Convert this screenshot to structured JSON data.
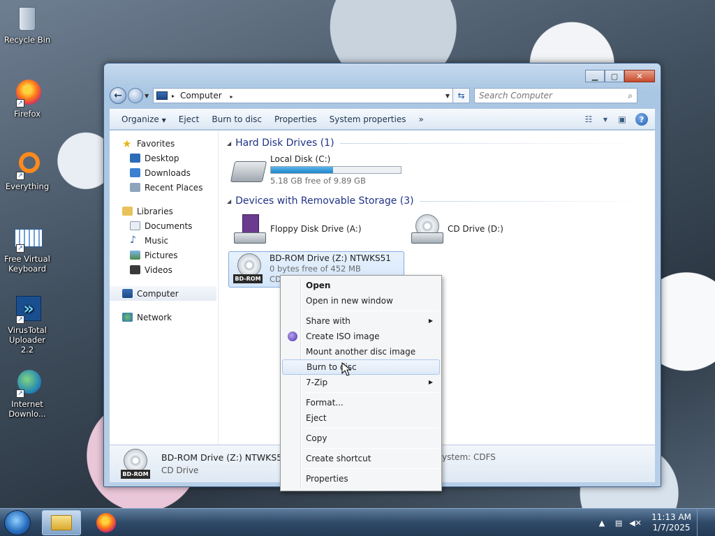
{
  "desktop": {
    "icons": [
      {
        "label": "Recycle Bin"
      },
      {
        "label": "Firefox"
      },
      {
        "label": "Everything"
      },
      {
        "label": "Free Virtual Keyboard"
      },
      {
        "label": "VirusTotal Uploader 2.2"
      },
      {
        "label": "Internet Downlo..."
      }
    ]
  },
  "window": {
    "address": {
      "path": "Computer",
      "separator": "▸"
    },
    "search": {
      "placeholder": "Search Computer"
    },
    "toolbar": {
      "organize": "Organize",
      "eject": "Eject",
      "burn": "Burn to disc",
      "properties": "Properties",
      "system_properties": "System properties",
      "more": "»"
    },
    "nav": {
      "favorites": "Favorites",
      "desktop": "Desktop",
      "downloads": "Downloads",
      "recent": "Recent Places",
      "libraries": "Libraries",
      "documents": "Documents",
      "music": "Music",
      "pictures": "Pictures",
      "videos": "Videos",
      "computer": "Computer",
      "network": "Network"
    },
    "groups": {
      "hdd": "Hard Disk Drives (1)",
      "removable": "Devices with Removable Storage (3)"
    },
    "drives": {
      "c": {
        "name": "Local Disk (C:)",
        "free": "5.18 GB free of 9.89 GB",
        "used_fraction": 0.476
      },
      "a": {
        "name": "Floppy Disk Drive (A:)"
      },
      "d": {
        "name": "CD Drive (D:)"
      },
      "z": {
        "name": "BD-ROM Drive (Z:) NTWKS51",
        "free": "0 bytes free of 452 MB",
        "fs": "CD",
        "tag": "BD-ROM"
      }
    },
    "details": {
      "name": "BD-ROM Drive (Z:) NTWKS51",
      "type": "CD Drive",
      "filesystem": "ystem: CDFS",
      "tag": "BD-ROM"
    }
  },
  "context_menu": {
    "open": "Open",
    "open_new": "Open in new window",
    "share": "Share with",
    "create_iso": "Create ISO image",
    "mount": "Mount another disc image",
    "burn": "Burn to disc",
    "zip": "7-Zip",
    "format": "Format...",
    "eject": "Eject",
    "copy": "Copy",
    "shortcut": "Create shortcut",
    "properties": "Properties"
  },
  "taskbar": {
    "time": "11:13 AM",
    "date": "1/7/2025"
  },
  "colors": {
    "accent": "#1f86cb",
    "group_header": "#1e3287",
    "selection": "#d3e6fb"
  }
}
